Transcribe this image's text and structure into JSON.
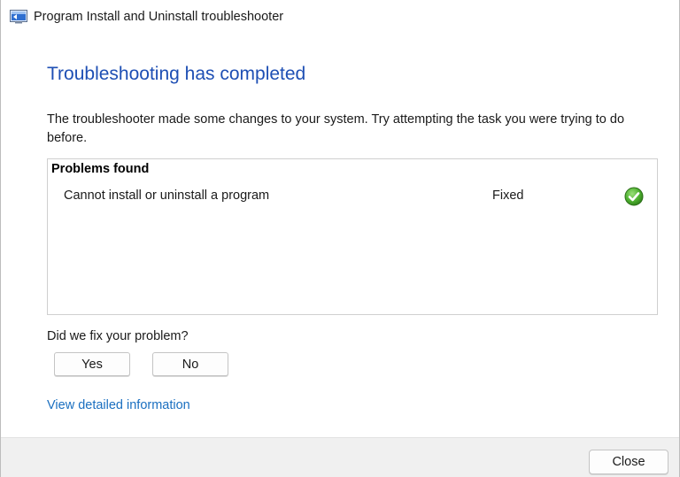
{
  "window": {
    "title": "Program Install and Uninstall troubleshooter",
    "icon": "troubleshooter-app-icon"
  },
  "main": {
    "heading": "Troubleshooting has completed",
    "description": "The troubleshooter made some changes to your system. Try attempting the task you were trying to do before."
  },
  "problems": {
    "header": "Problems found",
    "items": [
      {
        "name": "Cannot install or uninstall a program",
        "status": "Fixed",
        "status_icon": "green-check-icon"
      }
    ]
  },
  "feedback": {
    "question": "Did we fix your problem?",
    "yes_label": "Yes",
    "no_label": "No"
  },
  "details_link": "View detailed information",
  "footer": {
    "close_label": "Close"
  },
  "colors": {
    "heading": "#1e4fb4",
    "link": "#1a6fc0",
    "fixed_check": "#4caf2e",
    "footer_bg": "#f0f0f0"
  }
}
